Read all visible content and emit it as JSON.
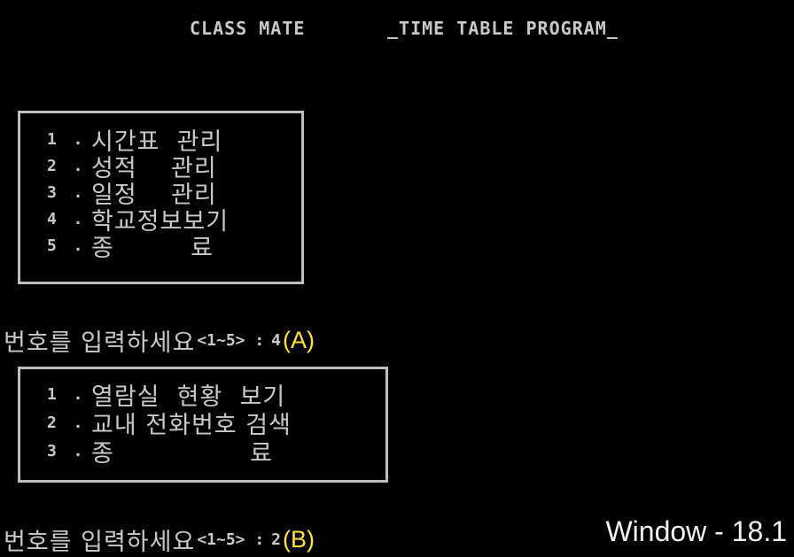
{
  "header": {
    "app_name": "CLASS MATE",
    "program_title": "_TIME TABLE PROGRAM_"
  },
  "main_menu": {
    "items": [
      {
        "num": "1",
        "dot": ".",
        "label": "시간표  관리"
      },
      {
        "num": "2",
        "dot": ".",
        "label": "성적    관리"
      },
      {
        "num": "3",
        "dot": ".",
        "label": "일정    관리"
      },
      {
        "num": "4",
        "dot": ".",
        "label": "학교정보보기"
      },
      {
        "num": "5",
        "dot": ".",
        "label": "종         료"
      }
    ]
  },
  "prompt_a": {
    "text": "번호를 입력하세요",
    "range": "<1~5> :",
    "value": "4",
    "annotation": "(A)"
  },
  "sub_menu": {
    "items": [
      {
        "num": "1",
        "dot": ".",
        "label": "열람실  현황  보기"
      },
      {
        "num": "2",
        "dot": ".",
        "label": "교내 전화번호 검색"
      },
      {
        "num": "3",
        "dot": ".",
        "label": "종                료"
      }
    ]
  },
  "prompt_b": {
    "text": "번호를 입력하세요",
    "range": "<1~5> :",
    "value": "2",
    "annotation": "(B)"
  },
  "caption": "Window - 18.1",
  "colors": {
    "background": "#000000",
    "text": "#c8c8c8",
    "border": "#bdbdbd",
    "annotation": "#ffe23a"
  }
}
